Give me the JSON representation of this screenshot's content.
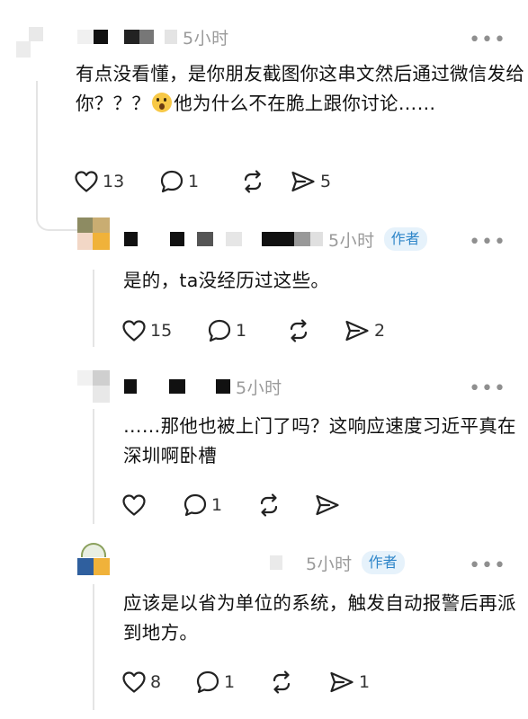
{
  "comments": [
    {
      "time": "5小时",
      "text_a": "有点没看懂，是你朋友截图你这串文然后通过微信发给你？？？",
      "text_b": "他为什么不在脆上跟你讨论……",
      "emoji": "hushed-face",
      "likes": "13",
      "replies": "1",
      "reposts": "",
      "shares": "5"
    },
    {
      "time": "5小时",
      "author_tag": "作者",
      "text": "是的，ta没经历过这些。",
      "likes": "15",
      "replies": "1",
      "reposts": "",
      "shares": "2"
    },
    {
      "time": "5小时",
      "text": "……那他也被上门了吗？这响应速度习近平真在深圳啊卧槽",
      "likes": "",
      "replies": "1",
      "reposts": "",
      "shares": ""
    },
    {
      "time": "5小时",
      "author_tag": "作者",
      "text": "应该是以省为单位的系统，触发自动报警后再派到地方。",
      "likes": "8",
      "replies": "1",
      "reposts": "",
      "shares": "1"
    }
  ],
  "more_label": "•••",
  "colors": {
    "tag_bg": "#e6f2fb",
    "tag_fg": "#2f86c9",
    "muted": "#9a9a9a",
    "line": "#e4e4e4"
  },
  "icons": [
    "heart-icon",
    "comment-icon",
    "repost-icon",
    "share-icon",
    "more-icon"
  ]
}
